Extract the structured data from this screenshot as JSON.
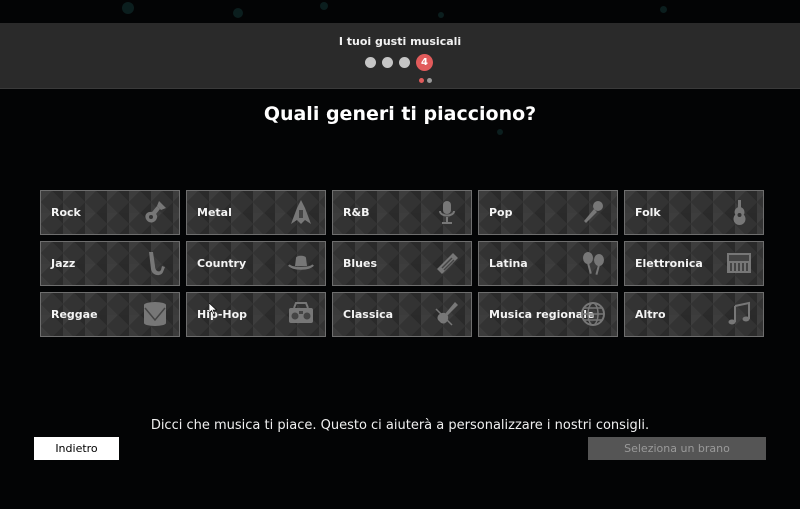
{
  "header": {
    "title": "I tuoi gusti musicali",
    "current_step": "4",
    "steps_total": 4
  },
  "question": "Quali generi ti piacciono?",
  "genres": [
    {
      "label": "Rock",
      "icon": "electric-guitar-icon"
    },
    {
      "label": "Metal",
      "icon": "metal-guitar-icon"
    },
    {
      "label": "R&B",
      "icon": "studio-microphone-icon"
    },
    {
      "label": "Pop",
      "icon": "handheld-microphone-icon"
    },
    {
      "label": "Folk",
      "icon": "acoustic-guitar-icon"
    },
    {
      "label": "Jazz",
      "icon": "saxophone-icon"
    },
    {
      "label": "Country",
      "icon": "cowboy-hat-icon"
    },
    {
      "label": "Blues",
      "icon": "harmonica-icon"
    },
    {
      "label": "Latina",
      "icon": "maracas-icon"
    },
    {
      "label": "Elettronica",
      "icon": "synthesizer-icon"
    },
    {
      "label": "Reggae",
      "icon": "drum-icon"
    },
    {
      "label": "Hip-Hop",
      "icon": "boombox-icon"
    },
    {
      "label": "Classica",
      "icon": "violin-icon"
    },
    {
      "label": "Musica regionale",
      "icon": "globe-icon"
    },
    {
      "label": "Altro",
      "icon": "music-notes-icon"
    }
  ],
  "info_text": "Dicci che musica ti piace. Questo ci aiuterà a personalizzare i nostri consigli.",
  "buttons": {
    "back": "Indietro",
    "next": "Seleziona un brano"
  },
  "colors": {
    "accent": "#e15b5b",
    "background": "#030405",
    "header_bg": "#2a2a2a",
    "tile_bg": "#333333",
    "disabled_button": "#555555"
  }
}
